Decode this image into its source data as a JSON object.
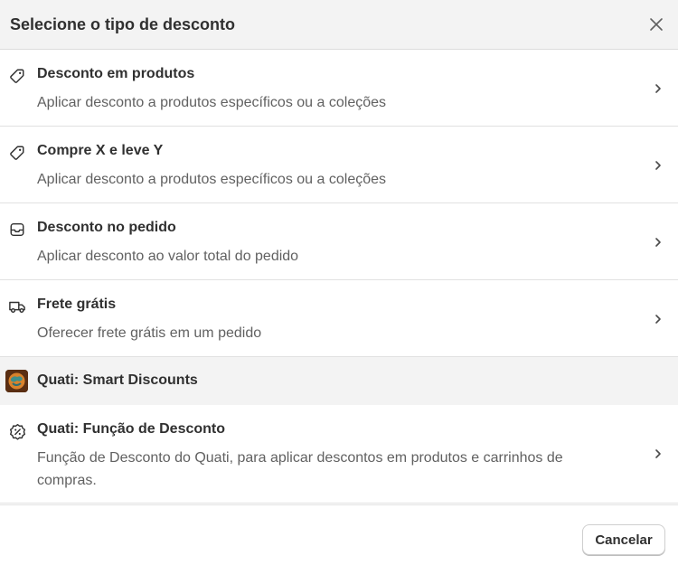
{
  "header": {
    "title": "Selecione o tipo de desconto",
    "close_icon": "close-icon"
  },
  "options": [
    {
      "icon": "tag-icon",
      "title": "Desconto em produtos",
      "description": "Aplicar desconto a produtos específicos ou a coleções"
    },
    {
      "icon": "tag-icon",
      "title": "Compre X e leve Y",
      "description": "Aplicar desconto a produtos específicos ou a coleções"
    },
    {
      "icon": "order-icon",
      "title": "Desconto no pedido",
      "description": "Aplicar desconto ao valor total do pedido"
    },
    {
      "icon": "truck-icon",
      "title": "Frete grátis",
      "description": "Oferecer frete grátis em um pedido"
    }
  ],
  "app_section": {
    "title": "Quati: Smart Discounts",
    "icon": "app-logo-icon"
  },
  "app_option": {
    "icon": "discount-badge-icon",
    "title": "Quati: Função de Desconto",
    "description": "Função de Desconto do Quati, para aplicar descontos em produtos e carrinhos de compras."
  },
  "footer": {
    "cancel_label": "Cancelar"
  }
}
